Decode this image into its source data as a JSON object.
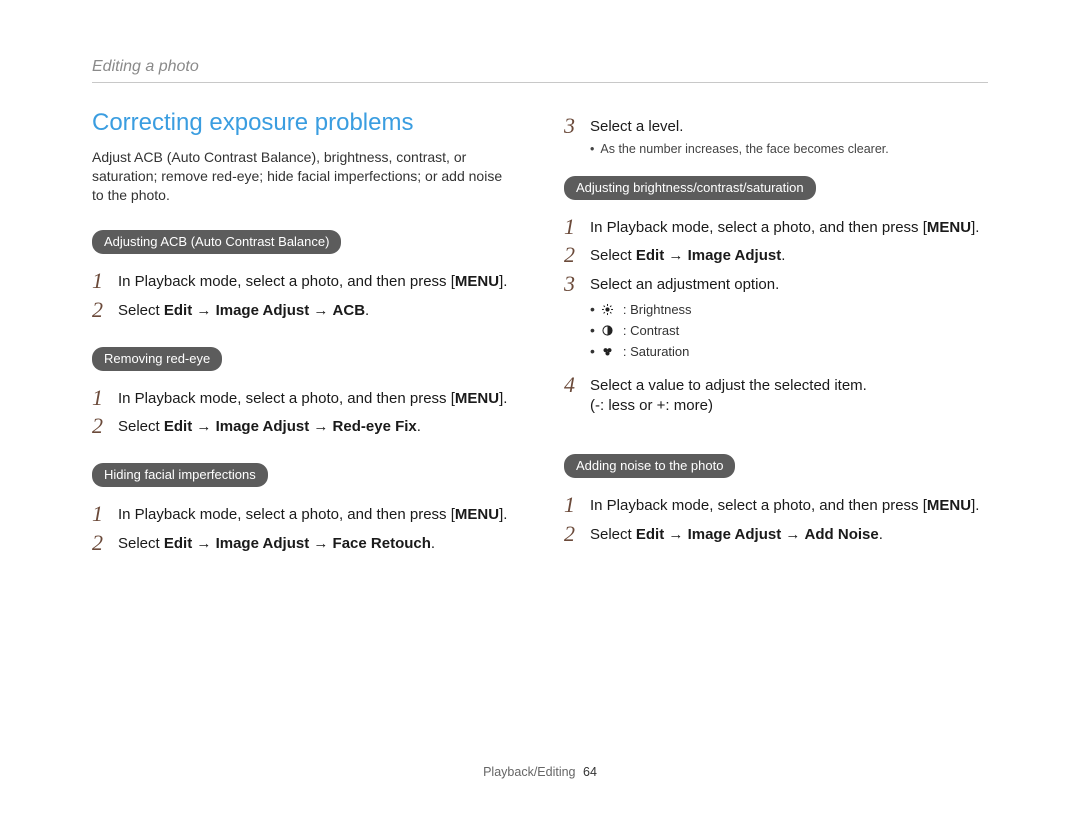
{
  "running_head": "Editing a photo",
  "heading": "Correcting exposure problems",
  "intro": "Adjust ACB (Auto Contrast Balance), brightness, contrast, or saturation; remove red-eye; hide facial imperfections; or add noise to the photo.",
  "labels": {
    "menu": "MENU",
    "select": "Select",
    "edit": "Edit",
    "image_adjust": "Image Adjust",
    "acb": "ACB",
    "redeye_fix": "Red-eye Fix",
    "face_retouch": "Face Retouch",
    "add_noise": "Add Noise",
    "arrow": "→"
  },
  "steps_text": {
    "in_playback": "In Playback mode, select a photo, and then press",
    "select_level": "Select a level.",
    "select_adjustment_option": "Select an adjustment option.",
    "select_value_line1": "Select a value to adjust the selected item.",
    "select_value_line2": "(-: less or +: more)"
  },
  "pills": {
    "acb": "Adjusting ACB (Auto Contrast Balance)",
    "redeye": "Removing red-eye",
    "face": "Hiding facial imperfections",
    "bcs": "Adjusting brightness/contrast/saturation",
    "noise": "Adding noise to the photo"
  },
  "notes": {
    "level_note": "As the number increases, the face becomes clearer."
  },
  "adjust_options": {
    "brightness": ": Brightness",
    "contrast": ": Contrast",
    "saturation": ": Saturation"
  },
  "footer": {
    "section": "Playback/Editing",
    "page": "64"
  }
}
